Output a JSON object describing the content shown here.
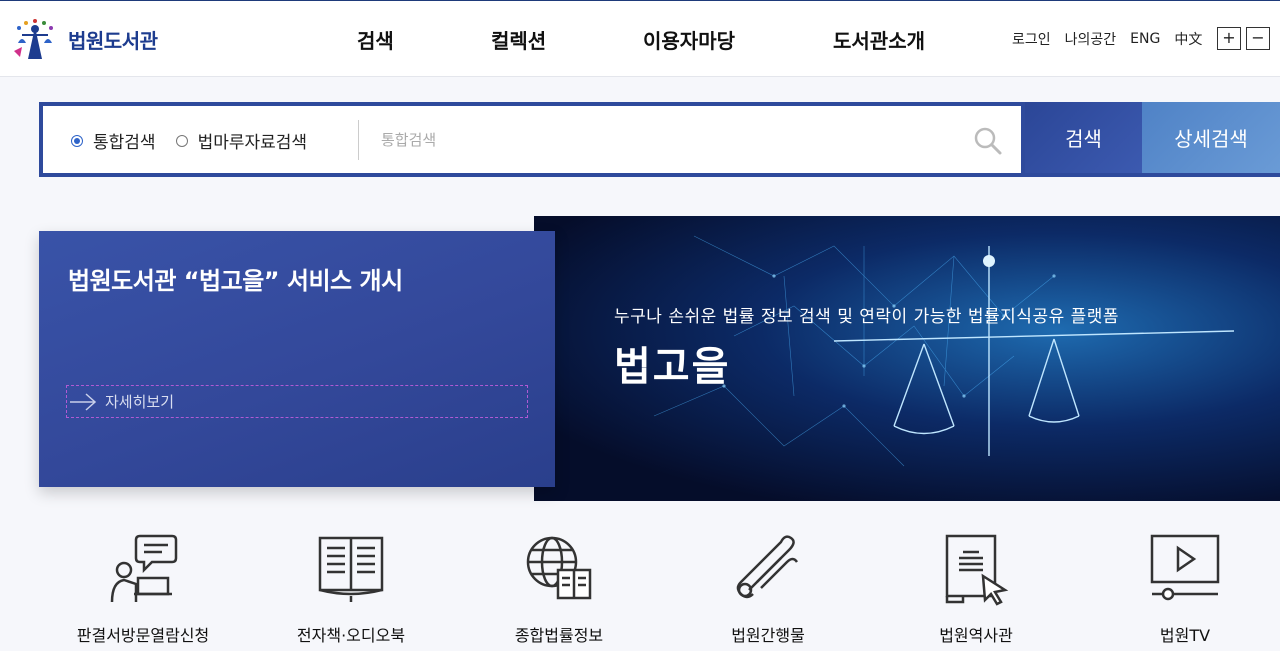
{
  "header": {
    "logo_text": "법원도서관",
    "nav": [
      "검색",
      "컬렉션",
      "이용자마당",
      "도서관소개"
    ],
    "utility": [
      "로그인",
      "나의공간",
      "ENG",
      "中文"
    ],
    "zoom_in": "+",
    "zoom_out": "−"
  },
  "search": {
    "options": [
      "통합검색",
      "법마루자료검색"
    ],
    "selected": "통합검색",
    "placeholder": "통합검색",
    "search_button": "검색",
    "detail_button": "상세검색"
  },
  "banner": {
    "notice_title": "법원도서관 “법고을” 서비스 개시",
    "more_label": "자세히보기",
    "caption": "누구나 손쉬운 법률 정보 검색 및 연락이 가능한 법률지식공유 플랫폼",
    "title": "법고을"
  },
  "quick_links": [
    {
      "label": "판결서방문열람신청",
      "icon": "consult-icon"
    },
    {
      "label": "전자책·오디오북",
      "icon": "ebook-icon"
    },
    {
      "label": "종합법률정보",
      "icon": "globe-book-icon"
    },
    {
      "label": "법원간행물",
      "icon": "scroll-icon"
    },
    {
      "label": "법원역사관",
      "icon": "document-cursor-icon"
    },
    {
      "label": "법원TV",
      "icon": "tv-play-icon"
    }
  ],
  "colors": {
    "primary": "#2e4a9c",
    "accent": "#4f82c6",
    "card": "#3953a8"
  }
}
